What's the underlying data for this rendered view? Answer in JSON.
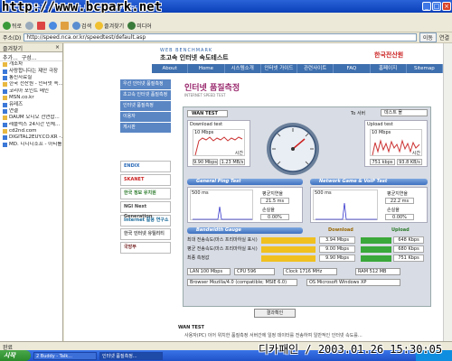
{
  "window": {
    "title": "인터넷 품질측정 - Microsoft Internet Explorer",
    "watermark": "http://www.bcpark.net"
  },
  "toolbar": {
    "back": "뒤로",
    "search": "검색",
    "favorites": "즐겨찾기",
    "media": "미디어"
  },
  "address": {
    "label": "주소(D)",
    "url": "http://speed.nca.or.kr/speedtest/default.asp",
    "go": "이동",
    "links": "연결"
  },
  "favorites": {
    "title": "즐겨찾기",
    "add": "추가...",
    "organize": "구성...",
    "items": [
      "개조차",
      "사랑합니다는 제안 극장",
      "통신자료실",
      "한국 전산원 - 인터넷 속...",
      "코리아 포인트 메인",
      "MSN.co.kr",
      "유레즈",
      "연결",
      "DAUM 오디오 천연합...",
      "레플럭스 24시간 민체...",
      "cd2nd.com",
      "DIGITAL2EUY.CO.KR -...",
      "MD. 디디디소프 - 아티를..."
    ]
  },
  "site": {
    "logo_en": "WEB BENCHMARK",
    "logo_ko": "초고속 인터넷 속도테스트",
    "brand": "한국전산원",
    "nav": [
      "About",
      "Home",
      "시스템소개",
      "인터넷 가이드",
      "관련사이트",
      "FAQ",
      "홈페이지",
      "Sitemap"
    ],
    "side_menu": [
      "우선 인터넷 품질측정",
      "초고속 인터넷 품질측정",
      "인터넷 품질측정",
      "이용자",
      "게시판"
    ],
    "banners": [
      "ENDIX",
      "SKANET",
      "한국 정보 유치원",
      "NGI Next Generation",
      "Internet 활용 연구소",
      "한국 인터넷 유틸리티",
      "국방부"
    ]
  },
  "test": {
    "heading": "인터넷 품질측정",
    "subheading": "INTERNET SPEED TEST",
    "tab": "WAN TEST",
    "to_label": "To 서버",
    "to_value": "데스트 몰",
    "download": {
      "title": "Download test",
      "scale": "10 Mbps",
      "time_label": "시간",
      "speed": "9.90 Mbps",
      "size": "1.23 MB/s"
    },
    "upload": {
      "title": "Upload test",
      "scale": "10 Mbps",
      "time_label": "시간",
      "speed": "751 kbps",
      "size": "93.8 KB/s"
    },
    "ping_bar": "General Ping Test",
    "game_bar": "Network Game & VoIP Test",
    "ping": {
      "scale": "500 ms",
      "avg_label": "평균지연율",
      "avg": "21.5 ms",
      "loss_label": "손실율",
      "loss": "0.00%"
    },
    "game": {
      "scale": "500 ms",
      "avg_label": "평균지연율",
      "avg": "22.2 ms",
      "loss_label": "손실율",
      "loss": "0.00%"
    },
    "bw_bar": "Bandwidth Gauge",
    "dl_head": "Download",
    "ul_head": "Upload",
    "rows": [
      {
        "label": "최대 전송속도(마스 프리마하실 표시)",
        "dl": "3.94 Mbps",
        "ul": "648 Kbps"
      },
      {
        "label": "평균 전송속도(마스 프리마하실 표시)",
        "dl": "9.00 Mbps",
        "ul": "680 Kbps"
      },
      {
        "label": "최종 측정값",
        "dl": "9.90 Mbps",
        "ul": "751 Kbps"
      }
    ],
    "lan_label": "LAN",
    "lan": "100 Mbps",
    "cpu_label": "CPU",
    "cpu": "596",
    "clock_label": "Clock",
    "clock": "1716 MHz",
    "ram_label": "RAM",
    "ram": "512 MB",
    "browser_label": "Browser",
    "browser": "Mozilla/4.0 (compatible; MSIE 6.0)",
    "os_label": "OS",
    "os": "Microsoft Windows XP",
    "result_button": "결과확인",
    "note_title": "WAN TEST",
    "note_text": "사용자(PC) 이어 위치한 품질측정 서버간에 일정 데이터를 전송하여 일반적인 인터넷 속도를..."
  },
  "status": {
    "text": "완료",
    "stamp": "디카패인 / 2003.01.26 15:30:05"
  },
  "taskbar": {
    "start": "시작",
    "tasks": [
      "2 Buddy - Talk...",
      "인터넷 품질측정..."
    ]
  },
  "colors": {
    "accent": "#3e6fae",
    "heading": "#9a2a6e",
    "download_bar": "#f0c020",
    "upload_bar": "#3aa83a"
  }
}
